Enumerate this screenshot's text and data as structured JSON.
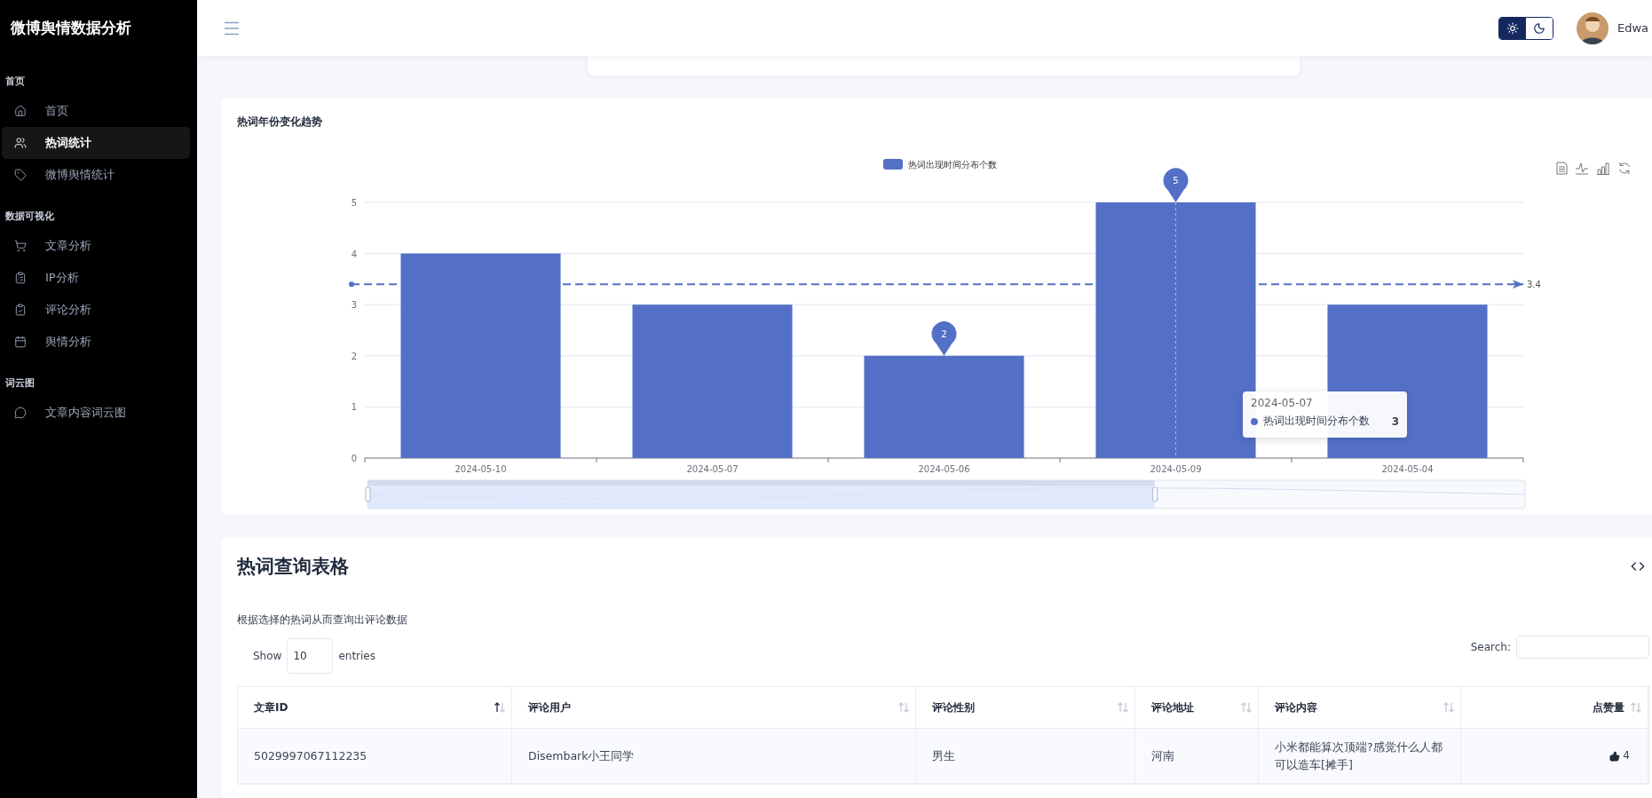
{
  "sidebar": {
    "brand": "微博舆情数据分析",
    "sections": [
      {
        "title": "首页",
        "items": [
          {
            "label": "首页",
            "selected": false
          },
          {
            "label": "热词统计",
            "selected": true
          },
          {
            "label": "微博舆情统计",
            "selected": false
          }
        ]
      },
      {
        "title": "数据可视化",
        "items": [
          {
            "label": "文章分析",
            "selected": false
          },
          {
            "label": "IP分析",
            "selected": false
          },
          {
            "label": "评论分析",
            "selected": false
          },
          {
            "label": "舆情分析",
            "selected": false
          }
        ]
      },
      {
        "title": "词云图",
        "items": [
          {
            "label": "文章内容词云图",
            "selected": false
          }
        ]
      }
    ]
  },
  "header": {
    "theme_options": [
      {
        "selected": true
      },
      {
        "selected": false
      }
    ],
    "user_name": "Edwa"
  },
  "trend_card": {
    "title": "热词年份变化趋势",
    "chart_data": {
      "type": "bar",
      "categories": [
        "2024-05-10",
        "2024-05-07",
        "2024-05-06",
        "2024-05-09",
        "2024-05-04"
      ],
      "series": [
        {
          "name": "热词出现时间分布个数",
          "color": "#5470c6",
          "values": [
            4,
            3,
            2,
            5,
            3
          ]
        }
      ],
      "ylim": [
        0,
        5
      ],
      "yticks": [
        0,
        1,
        2,
        3,
        4,
        5
      ],
      "grid": true,
      "annotations": [
        {
          "x": "2024-05-06",
          "y": 2,
          "text": "2"
        },
        {
          "x": "2024-05-09",
          "y": 5,
          "text": "5"
        }
      ],
      "ref_lines": [
        {
          "axis": "y",
          "value": 3.4,
          "label": "3.4"
        },
        {
          "axis": "x",
          "value": "2024-05-09"
        }
      ]
    },
    "data_zoom": {
      "level": 0.68
    },
    "tooltip": {
      "title": "2024-05-07",
      "series": "热词出现时间分布个数",
      "value": "3"
    }
  },
  "table_card": {
    "title": "热词查询表格",
    "description": "根据选择的热词从而查询出评论数据",
    "show_label": "Show",
    "page_size": "10",
    "entries_label": "entries",
    "search_label": "Search:",
    "columns": [
      {
        "label": "文章ID",
        "sorted_ascending": true
      },
      {
        "label": "评论用户",
        "sorted_ascending": false
      },
      {
        "label": "评论性别",
        "sorted_ascending": false
      },
      {
        "label": "评论地址",
        "sorted_ascending": false
      },
      {
        "label": "评论内容",
        "sorted_ascending": false
      },
      {
        "label": "点赞量",
        "sorted_ascending": false
      }
    ],
    "rows": [
      {
        "cells": [
          "5029997067112235",
          "Disembark小王同学",
          "男生",
          "河南",
          "小米都能算次顶端?感觉什么人都可以造车[摊手]",
          "4"
        ]
      }
    ]
  }
}
